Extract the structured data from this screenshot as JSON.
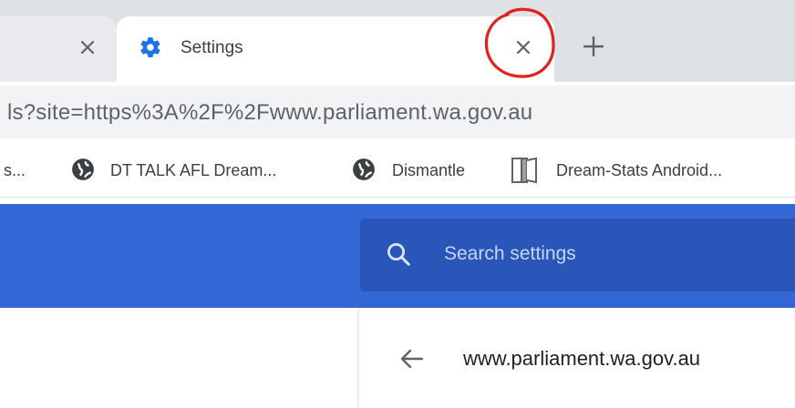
{
  "tabs": [
    {
      "title": "",
      "close_glyph": "✕"
    },
    {
      "title": "Settings",
      "icon": "gear-icon",
      "close_glyph": "✕",
      "active": true
    }
  ],
  "new_tab_glyph": "+",
  "omnibox": {
    "url": "ls?site=https%3A%2F%2Fwww.parliament.wa.gov.au"
  },
  "bookmarks": [
    {
      "label": "s...",
      "icon": null
    },
    {
      "label": "DT TALK  AFL Dream...",
      "icon": "globe-icon"
    },
    {
      "label": "Dismantle",
      "icon": "globe-icon"
    },
    {
      "label": "Dream-Stats Android...",
      "icon": "book-icon"
    }
  ],
  "settings": {
    "search_placeholder": "Search settings",
    "site_title": "www.parliament.wa.gov.au",
    "back_glyph": "←"
  },
  "colors": {
    "header": "#3367d6",
    "search_box": "#2a56b9",
    "annotation": "#e3201b",
    "tab_strip": "#dee1e6"
  }
}
